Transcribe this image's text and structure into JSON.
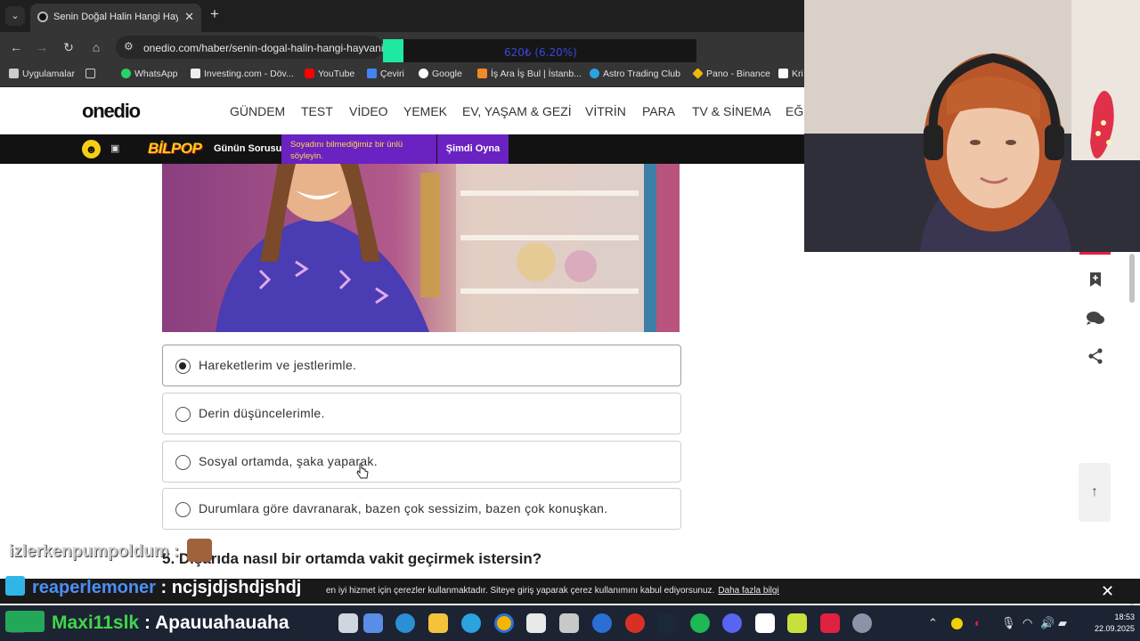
{
  "browser": {
    "tab_title": "Senin Doğal Halin Hangi Hayvan",
    "url": "onedio.com/haber/senin-dogal-halin-hangi-hayvani",
    "overlay_value": "620₺ (6.20%)",
    "bookmarks": [
      {
        "label": "Uygulamalar",
        "icon": "apps-grid-icon",
        "color": "#cccccc"
      },
      {
        "label": "WhatsApp",
        "icon": "whatsapp-icon",
        "color": "#25d366"
      },
      {
        "label": "Investing.com - Döv...",
        "icon": "investing-icon",
        "color": "#eeeeee"
      },
      {
        "label": "YouTube",
        "icon": "youtube-icon",
        "color": "#ff0000"
      },
      {
        "label": "Çeviri",
        "icon": "translate-icon",
        "color": "#4285f4"
      },
      {
        "label": "Google",
        "icon": "google-icon",
        "color": "#ffffff"
      },
      {
        "label": "İş Ara İş Bul | İstanb...",
        "icon": "kariyer-icon",
        "color": "#f08a24"
      },
      {
        "label": "Astro Trading Club",
        "icon": "telegram-icon",
        "color": "#2aa3df"
      },
      {
        "label": "Pano - Binance",
        "icon": "binance-icon",
        "color": "#f0b90b"
      },
      {
        "label": "Kri",
        "icon": "bookmark-icon",
        "color": "#ffffff"
      }
    ]
  },
  "site": {
    "logo": "onedio",
    "nav": [
      "GÜNDEM",
      "TEST",
      "VİDEO",
      "YEMEK",
      "EV, YAŞAM & GEZİ",
      "VİTRİN",
      "PARA",
      "TV & SİNEMA",
      "EĞİ"
    ],
    "bilpop": {
      "logo": "BİLPOP",
      "daily_question": "Günün Sorusu",
      "question_text": "Soyadını bilmediğimiz bir ünlü söyleyin.",
      "play_label": "Şimdi Oyna"
    }
  },
  "quiz": {
    "answers": [
      {
        "label": "Hareketlerim ve jestlerimle.",
        "selected": true
      },
      {
        "label": "Derin düşüncelerimle.",
        "selected": false
      },
      {
        "label": "Sosyal ortamda, şaka yaparak.",
        "selected": false
      },
      {
        "label": "Durumlara göre davranarak, bazen çok sessizim, bazen çok konuşkan.",
        "selected": false
      }
    ],
    "next_question": "5. Dışarıda nasıl bir ortamda vakit geçirmek istersin?"
  },
  "cookie": {
    "text": "en iyi hizmet için çerezler kullanmaktadır. Siteye giriş yaparak çerez kullanımını kabul ediyorsunuz.",
    "link": "Daha fazla bilgi"
  },
  "chat": [
    {
      "user": "izlerkenpumpoldum",
      "separator": ":",
      "message": ""
    },
    {
      "user": "reaperlemoner",
      "separator": ":",
      "message": "ncjsjdjshdjshdj"
    },
    {
      "user": "Maxi11slk",
      "separator": ":",
      "message": "Apauuahauaha"
    }
  ],
  "taskbar": {
    "time": "18:53",
    "date": "22.09.2025"
  }
}
